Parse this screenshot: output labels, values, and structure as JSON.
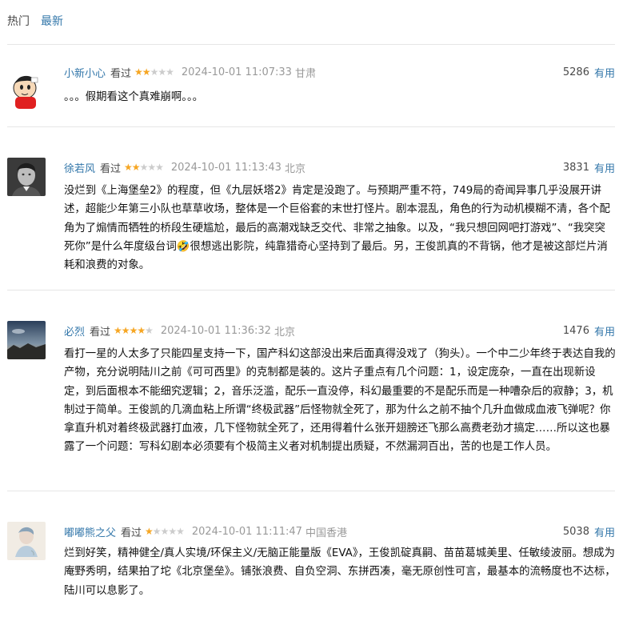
{
  "tabs": [
    {
      "label": "热门",
      "active": false
    },
    {
      "label": "最新",
      "active": true
    }
  ],
  "useful_label": "有用",
  "reviews": [
    {
      "author": "小新小心",
      "status": "看过",
      "rating": 2,
      "time": "2024-10-01 11:07:33",
      "location": "甘肃",
      "votes": "5286",
      "content": "。。。假期看这个真难崩啊。。。"
    },
    {
      "author": "徐若风",
      "status": "看过",
      "rating": 2,
      "time": "2024-10-01 11:13:43",
      "location": "北京",
      "votes": "3831",
      "content": "没烂到《上海堡垒2》的程度，但《九层妖塔2》肯定是没跑了。与预期严重不符，749局的奇闻异事几乎没展开讲述，超能少年第三小队也草草收场，整体是一个巨俗套的末世打怪片。剧本混乱，角色的行为动机模糊不清，各个配角为了煽情而牺牲的桥段生硬尴尬，最后的高潮戏缺乏交代、非常之抽象。以及，“我只想回网吧打游戏”、“我突突死你”是什么年度级台词🤣很想逃出影院，纯靠猎奇心坚持到了最后。另，王俊凯真的不背锅，他才是被这部烂片消耗和浪费的对象。"
    },
    {
      "author": "必烈",
      "status": "看过",
      "rating": 4,
      "time": "2024-10-01 11:36:32",
      "location": "北京",
      "votes": "1476",
      "content": "看打一星的人太多了只能四星支持一下，国产科幻这部没出来后面真得没戏了（狗头）。一个中二少年终于表达自我的产物，充分说明陆川之前《可可西里》的克制都是装的。这片子重点有几个问题：1，设定庞杂，一直在出现新设定，到后面根本不能细究逻辑；2，音乐泛滥，配乐一直没停，科幻最重要的不是配乐而是一种嘈杂后的寂静；3，机制过于简单。王俊凯的几滴血粘上所谓“终极武器”后怪物就全死了，那为什么之前不抽个几升血做成血液飞弹呢？你拿直升机对着终极武器打血液，几下怪物就全死了，还用得着什么张开翅膀还飞那么高费老劲才搞定……所以这也暴露了一个问题：写科幻剧本必须要有个极简主义者对机制提出质疑，不然漏洞百出，苦的也是工作人员。"
    },
    {
      "author": "嘟嘟熊之父",
      "status": "看过",
      "rating": 1,
      "time": "2024-10-01 11:11:47",
      "location": "中国香港",
      "votes": "5038",
      "content": "烂到好笑，精神健全/真人实境/环保主义/无脑正能量版《EVA》，王俊凯碇真嗣、苗苗葛城美里、任敏绫波丽。想成为庵野秀明，结果拍了坨《北京堡垒》。铺张浪费、自负空洞、东拼西凑，毫无原创性可言，最基本的流畅度也不达标，陆川可以息影了。"
    }
  ],
  "colors": {
    "link": "#3377aa",
    "star": "#f6a623",
    "muted": "#999999"
  }
}
